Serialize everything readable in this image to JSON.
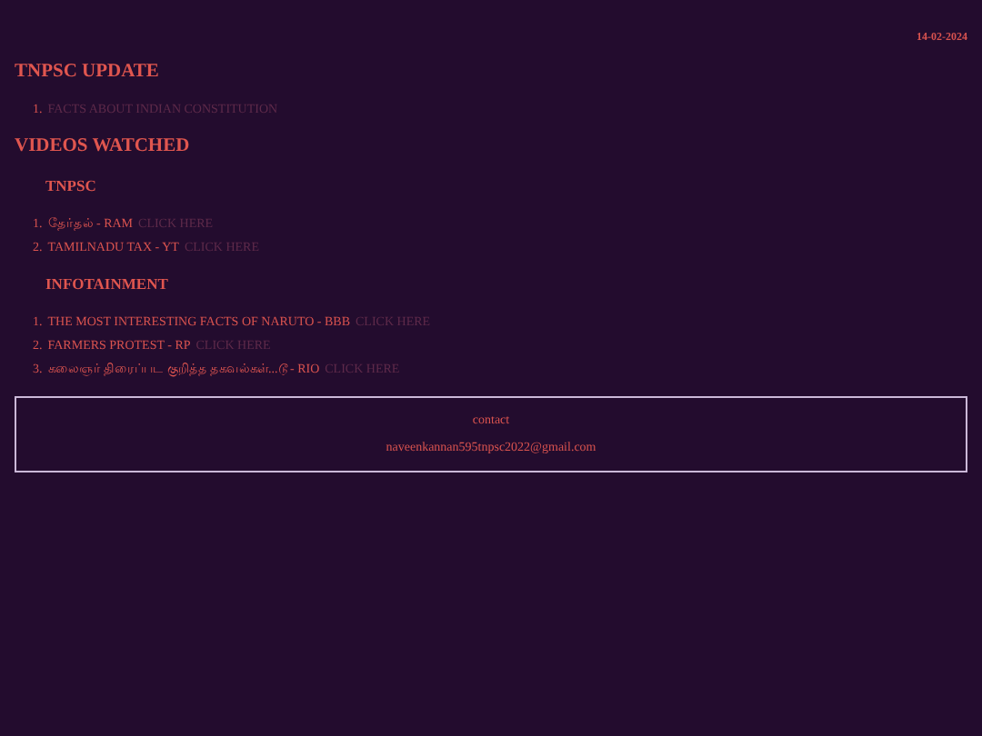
{
  "date": "14-02-2024",
  "update": {
    "title": "TNPSC UPDATE",
    "items": [
      {
        "number": "1.",
        "link": "FACTS ABOUT INDIAN CONSTITUTION"
      }
    ]
  },
  "videos": {
    "title": "VIDEOS WATCHED",
    "groups": [
      {
        "title": "TNPSC",
        "items": [
          {
            "number": "1.",
            "text": "தேர்தல் - RAM",
            "link": "CLICK HERE"
          },
          {
            "number": "2.",
            "text": "TAMILNADU TAX - YT",
            "link": "CLICK HERE"
          }
        ]
      },
      {
        "title": "INFOTAINMENT",
        "items": [
          {
            "number": "1.",
            "text": "THE MOST INTERESTING FACTS OF NARUTO - BBB",
            "link": "CLICK HERE"
          },
          {
            "number": "2.",
            "text": "FARMERS PROTEST - RP",
            "link": "CLICK HERE"
          },
          {
            "number": "3.",
            "text": "கலைஞர் திரைப்பட குறித்த தகவல்கள்...டூ - RIO",
            "link": "CLICK HERE"
          }
        ]
      }
    ]
  },
  "contact": {
    "label": "contact",
    "email": "naveenkannan595tnpsc2022@gmail.com"
  }
}
